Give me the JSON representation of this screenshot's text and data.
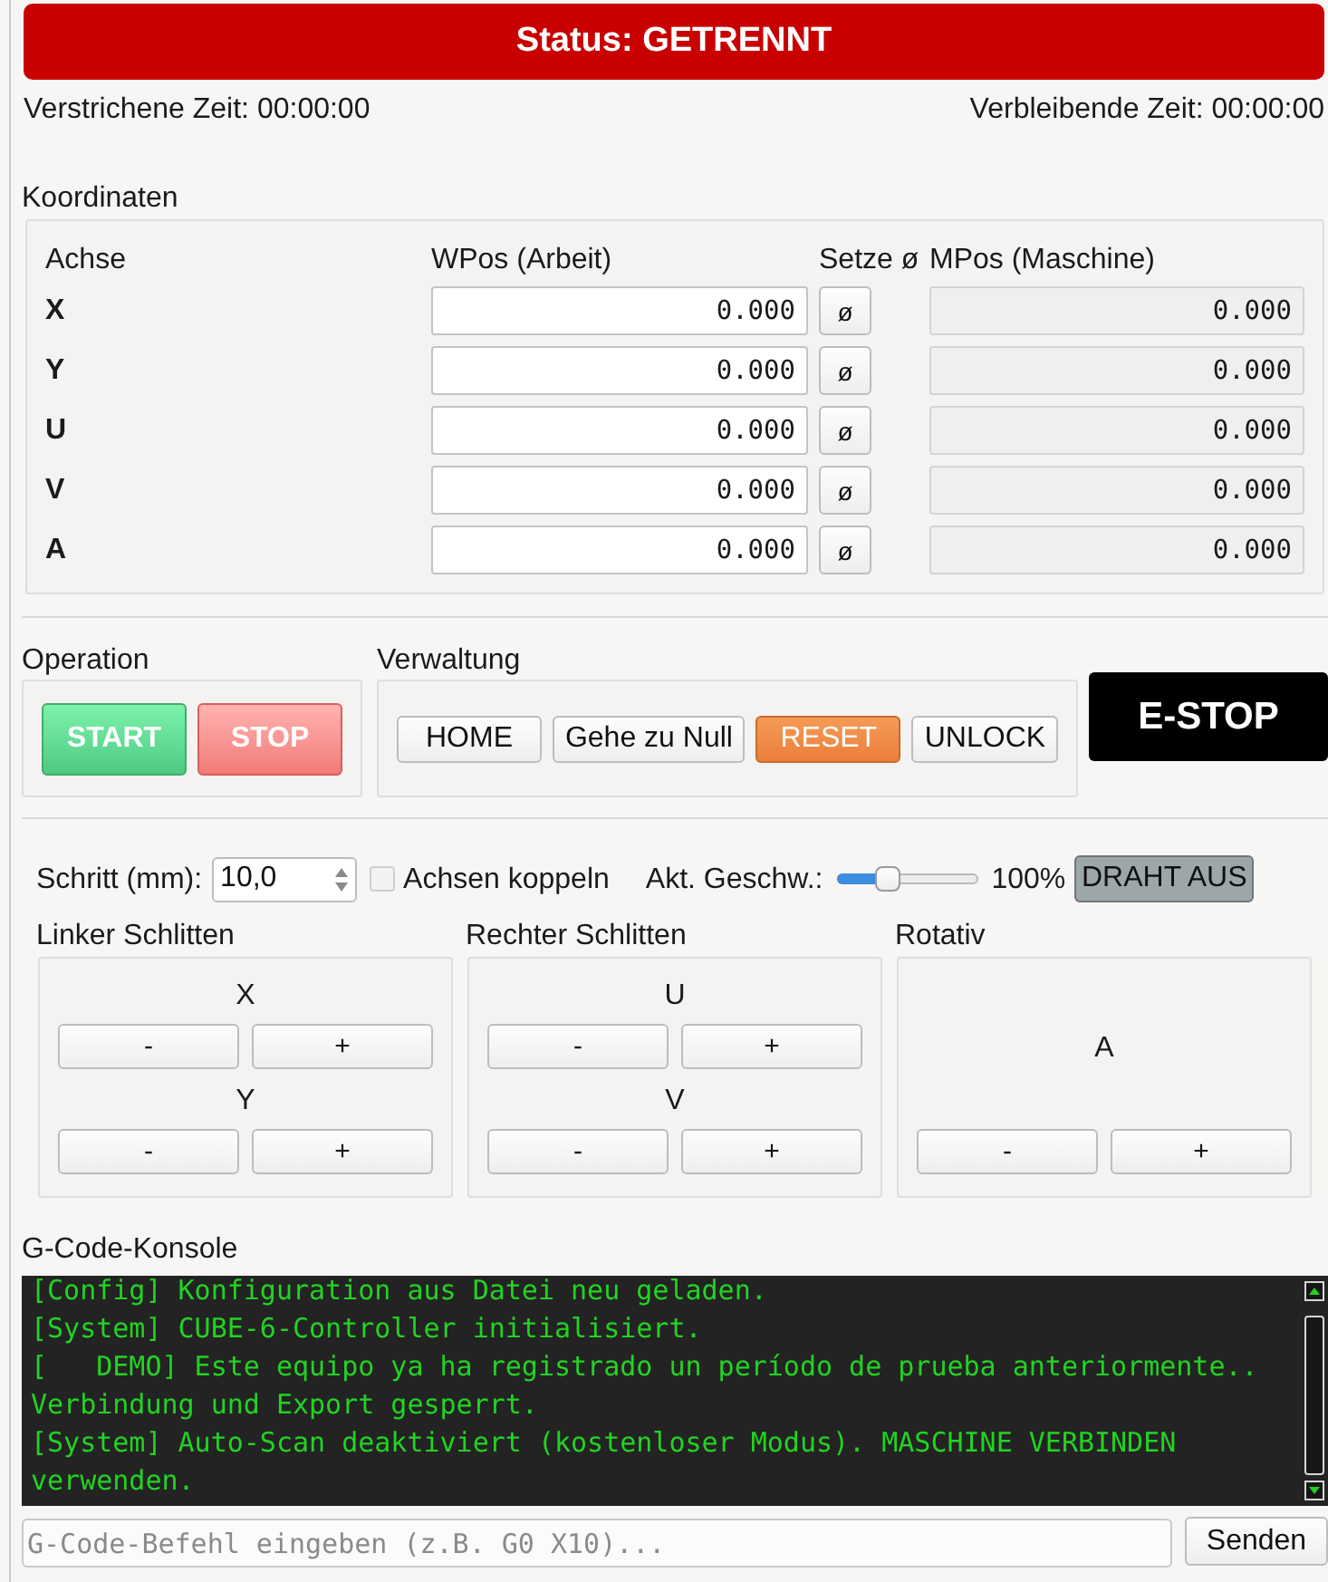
{
  "status": {
    "text": "Status: GETRENNT"
  },
  "timers": {
    "elapsed": "Verstrichene Zeit: 00:00:00",
    "remaining": "Verbleibende Zeit: 00:00:00"
  },
  "coordinates": {
    "title": "Koordinaten",
    "columns": [
      "Achse",
      "WPos (Arbeit)",
      "Setze ø",
      "MPos (Maschine)"
    ],
    "rows": [
      {
        "axis": "X",
        "wpos": "0.000",
        "set_zero": "ø",
        "mpos": "0.000"
      },
      {
        "axis": "Y",
        "wpos": "0.000",
        "set_zero": "ø",
        "mpos": "0.000"
      },
      {
        "axis": "U",
        "wpos": "0.000",
        "set_zero": "ø",
        "mpos": "0.000"
      },
      {
        "axis": "V",
        "wpos": "0.000",
        "set_zero": "ø",
        "mpos": "0.000"
      },
      {
        "axis": "A",
        "wpos": "0.000",
        "set_zero": "ø",
        "mpos": "0.000"
      }
    ]
  },
  "operation": {
    "title": "Operation",
    "buttons": [
      {
        "label": "START",
        "kind": "start"
      },
      {
        "label": "STOP",
        "kind": "stop"
      }
    ]
  },
  "management": {
    "title": "Verwaltung",
    "buttons": [
      {
        "label": "HOME",
        "kind": "plain"
      },
      {
        "label": "Gehe zu Null",
        "kind": "plain"
      },
      {
        "label": "RESET",
        "kind": "warning"
      },
      {
        "label": "UNLOCK",
        "kind": "plain"
      }
    ]
  },
  "estop": {
    "label": "E-STOP"
  },
  "jog_settings": {
    "step_label": "Schritt (mm):",
    "step_value": "10,0",
    "couple": {
      "label": "Achsen koppeln",
      "checked": false
    },
    "speed_label": "Akt. Geschw.:",
    "speed": {
      "level": 0.33
    },
    "speed_reading": "100%",
    "wire_button": "DRAHT AUS"
  },
  "jog_groups": [
    {
      "title": "Linker Schlitten",
      "axes": [
        {
          "name": "X",
          "minus": "-",
          "plus": "+"
        },
        {
          "name": "Y",
          "minus": "-",
          "plus": "+"
        }
      ]
    },
    {
      "title": "Rechter Schlitten",
      "axes": [
        {
          "name": "U",
          "minus": "-",
          "plus": "+"
        },
        {
          "name": "V",
          "minus": "-",
          "plus": "+"
        }
      ]
    },
    {
      "title": "Rotativ",
      "axes": [
        {
          "name": "A",
          "minus": "-",
          "plus": "+"
        }
      ]
    }
  ],
  "console": {
    "title": "G-Code-Konsole",
    "messages": [
      "[Config] Konfiguration aus Datei neu geladen.",
      "[System] CUBE-6-Controller initialisiert.",
      "[   DEMO] Este equipo ya ha registrado un período de prueba anteriormente.. Verbindung und Export gesperrt.",
      "[System] Auto-Scan deaktiviert (kostenloser Modus). MASCHINE VERBINDEN verwenden."
    ],
    "command": {
      "placeholder": "G-Code-Befehl eingeben (z.B. G0 X10)..."
    },
    "send_button": "Senden"
  }
}
